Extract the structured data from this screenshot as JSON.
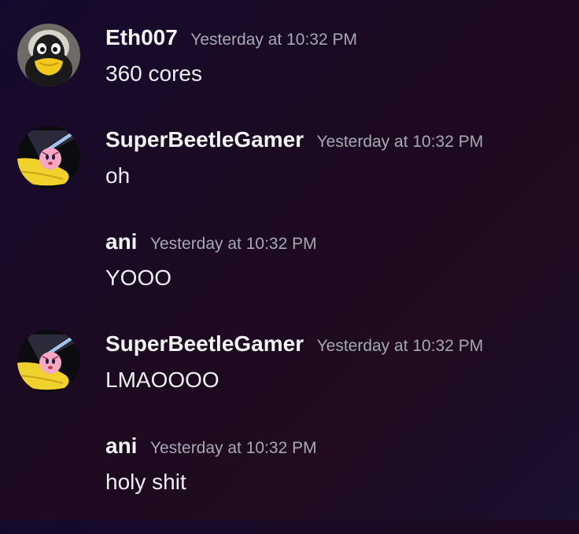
{
  "messages": [
    {
      "username": "Eth007",
      "timestamp": "Yesterday at 10:32 PM",
      "content": "360 cores",
      "avatar": "penguin-avatar"
    },
    {
      "username": "SuperBeetleGamer",
      "timestamp": "Yesterday at 10:32 PM",
      "content": "oh",
      "avatar": "kirby-avatar"
    },
    {
      "username": "ani",
      "timestamp": "Yesterday at 10:32 PM",
      "content": "YOOO",
      "avatar": ""
    },
    {
      "username": "SuperBeetleGamer",
      "timestamp": "Yesterday at 10:32 PM",
      "content": "LMAOOOO",
      "avatar": "kirby-avatar"
    },
    {
      "username": "ani",
      "timestamp": "Yesterday at 10:32 PM",
      "content": "holy shit",
      "avatar": ""
    }
  ],
  "colors": {
    "username": "#f2f3f5",
    "timestamp": "#a6a8b3",
    "content": "#eceef2"
  }
}
